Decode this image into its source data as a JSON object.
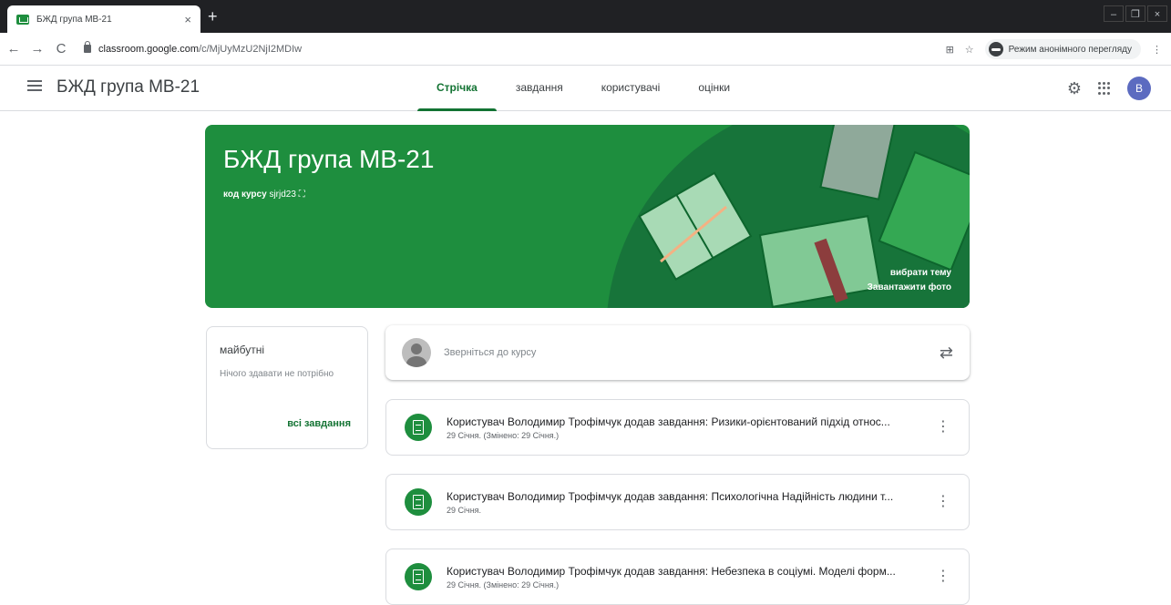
{
  "browser": {
    "tab_title": "БЖД група МВ-21",
    "tab_close": "×",
    "new_tab": "+",
    "back": "←",
    "forward": "→",
    "reload": "C",
    "url_domain": "classroom.google.com",
    "url_path": "/c/MjUyMzU2NjI2MDIw",
    "translate_icon": "⊞",
    "star": "☆",
    "incognito_label": "Режим анонімного перегляду",
    "menu": "⋮",
    "win_min": "–",
    "win_max": "❐",
    "win_close": "×"
  },
  "appbar": {
    "title": "БЖД група МВ-21",
    "tabs": [
      "Стрічка",
      "завдання",
      "користувачі",
      "оцінки"
    ],
    "gear": "⚙",
    "avatar": "B"
  },
  "banner": {
    "title": "БЖД група МВ-21",
    "code_label": "код курсу",
    "code_value": "sjrjd23",
    "expand_icon": "⛶",
    "select_theme": "вибрати тему",
    "upload_photo": "Завантажити фото"
  },
  "upcoming": {
    "heading": "майбутні",
    "empty": "Нічого здавати не потрібно",
    "all_link": "всі завдання"
  },
  "compose": {
    "placeholder": "Зверніться до курсу",
    "repost_icon": "⇄"
  },
  "posts": [
    {
      "title": "Користувач Володимир Трофімчук додав завдання: Ризики-орієнтований підхід относ...",
      "date": "29 Січня.  (Змінено: 29 Січня.)"
    },
    {
      "title": "Користувач Володимир Трофімчук додав завдання: Психологічна Надійність людини т...",
      "date": "29 Січня."
    },
    {
      "title": "Користувач Володимир Трофімчук додав завдання: Небезпека в соціумі. Моделі форм...",
      "date": "29 Січня.  (Змінено: 29 Січня.)"
    }
  ],
  "colors": {
    "accent": "#137333",
    "banner": "#1e8e3e",
    "avatar": "#5c6bc0"
  }
}
